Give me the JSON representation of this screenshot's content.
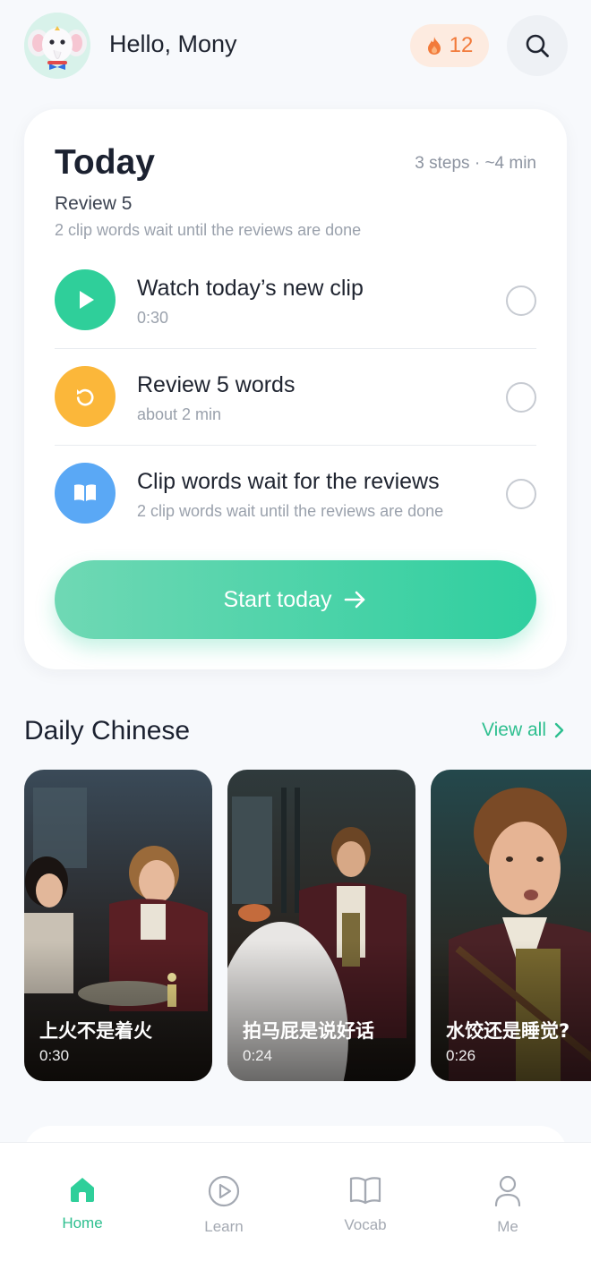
{
  "header": {
    "greeting": "Hello, Mony",
    "streak_count": "12",
    "streak_icon": "flame-icon",
    "search_icon": "search-icon",
    "avatar": "elephant-mascot"
  },
  "today": {
    "title": "Today",
    "meta": "3 steps · ~4 min",
    "subtitle": "Review 5",
    "note": "2 clip words wait until the reviews are done",
    "steps": [
      {
        "title": "Watch today’s new clip",
        "subtitle": "0:30",
        "icon": "play-icon",
        "color": "#2fcf9a"
      },
      {
        "title": "Review 5 words",
        "subtitle": "about 2 min",
        "icon": "refresh-icon",
        "color": "#fbb73a"
      },
      {
        "title": "Clip words wait for the reviews",
        "subtitle": "2 clip words wait until the reviews are done",
        "icon": "book-icon",
        "color": "#5aa8f5"
      }
    ],
    "start_label": "Start today"
  },
  "daily": {
    "title": "Daily Chinese",
    "view_all": "View all",
    "clips": [
      {
        "title": "上火不是着火",
        "duration": "0:30"
      },
      {
        "title": "拍马屁是说好话",
        "duration": "0:24"
      },
      {
        "title": "水饺还是睡觉?",
        "duration": "0:26"
      }
    ]
  },
  "nav": {
    "items": [
      {
        "label": "Home",
        "icon": "home-icon",
        "active": true
      },
      {
        "label": "Learn",
        "icon": "play-circle-icon",
        "active": false
      },
      {
        "label": "Vocab",
        "icon": "book-open-icon",
        "active": false
      },
      {
        "label": "Me",
        "icon": "user-icon",
        "active": false
      }
    ]
  },
  "colors": {
    "accent": "#2ebf8f",
    "streak": "#f27a3a",
    "background": "#f7f9fc"
  }
}
